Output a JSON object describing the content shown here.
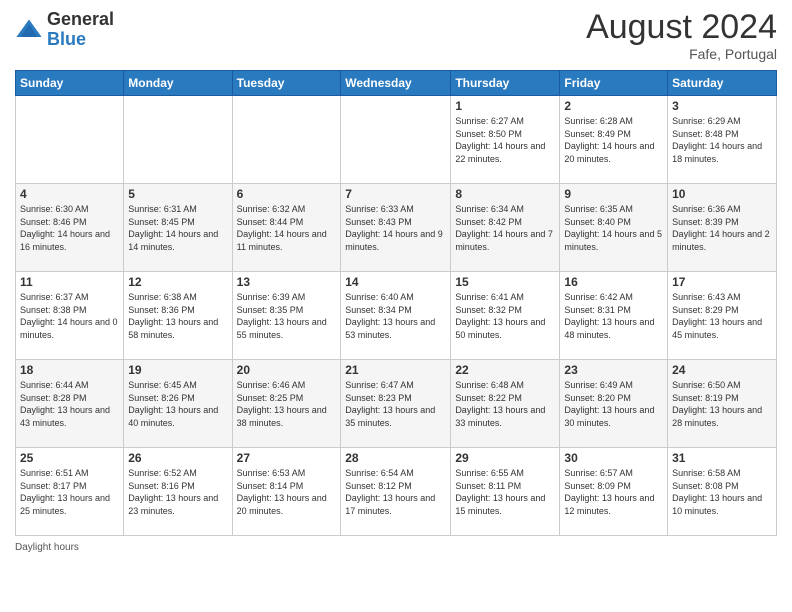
{
  "header": {
    "logo_general": "General",
    "logo_blue": "Blue",
    "month_year": "August 2024",
    "location": "Fafe, Portugal"
  },
  "days_of_week": [
    "Sunday",
    "Monday",
    "Tuesday",
    "Wednesday",
    "Thursday",
    "Friday",
    "Saturday"
  ],
  "weeks": [
    [
      {
        "day": "",
        "info": ""
      },
      {
        "day": "",
        "info": ""
      },
      {
        "day": "",
        "info": ""
      },
      {
        "day": "",
        "info": ""
      },
      {
        "day": "1",
        "info": "Sunrise: 6:27 AM\nSunset: 8:50 PM\nDaylight: 14 hours and 22 minutes."
      },
      {
        "day": "2",
        "info": "Sunrise: 6:28 AM\nSunset: 8:49 PM\nDaylight: 14 hours and 20 minutes."
      },
      {
        "day": "3",
        "info": "Sunrise: 6:29 AM\nSunset: 8:48 PM\nDaylight: 14 hours and 18 minutes."
      }
    ],
    [
      {
        "day": "4",
        "info": "Sunrise: 6:30 AM\nSunset: 8:46 PM\nDaylight: 14 hours and 16 minutes."
      },
      {
        "day": "5",
        "info": "Sunrise: 6:31 AM\nSunset: 8:45 PM\nDaylight: 14 hours and 14 minutes."
      },
      {
        "day": "6",
        "info": "Sunrise: 6:32 AM\nSunset: 8:44 PM\nDaylight: 14 hours and 11 minutes."
      },
      {
        "day": "7",
        "info": "Sunrise: 6:33 AM\nSunset: 8:43 PM\nDaylight: 14 hours and 9 minutes."
      },
      {
        "day": "8",
        "info": "Sunrise: 6:34 AM\nSunset: 8:42 PM\nDaylight: 14 hours and 7 minutes."
      },
      {
        "day": "9",
        "info": "Sunrise: 6:35 AM\nSunset: 8:40 PM\nDaylight: 14 hours and 5 minutes."
      },
      {
        "day": "10",
        "info": "Sunrise: 6:36 AM\nSunset: 8:39 PM\nDaylight: 14 hours and 2 minutes."
      }
    ],
    [
      {
        "day": "11",
        "info": "Sunrise: 6:37 AM\nSunset: 8:38 PM\nDaylight: 14 hours and 0 minutes."
      },
      {
        "day": "12",
        "info": "Sunrise: 6:38 AM\nSunset: 8:36 PM\nDaylight: 13 hours and 58 minutes."
      },
      {
        "day": "13",
        "info": "Sunrise: 6:39 AM\nSunset: 8:35 PM\nDaylight: 13 hours and 55 minutes."
      },
      {
        "day": "14",
        "info": "Sunrise: 6:40 AM\nSunset: 8:34 PM\nDaylight: 13 hours and 53 minutes."
      },
      {
        "day": "15",
        "info": "Sunrise: 6:41 AM\nSunset: 8:32 PM\nDaylight: 13 hours and 50 minutes."
      },
      {
        "day": "16",
        "info": "Sunrise: 6:42 AM\nSunset: 8:31 PM\nDaylight: 13 hours and 48 minutes."
      },
      {
        "day": "17",
        "info": "Sunrise: 6:43 AM\nSunset: 8:29 PM\nDaylight: 13 hours and 45 minutes."
      }
    ],
    [
      {
        "day": "18",
        "info": "Sunrise: 6:44 AM\nSunset: 8:28 PM\nDaylight: 13 hours and 43 minutes."
      },
      {
        "day": "19",
        "info": "Sunrise: 6:45 AM\nSunset: 8:26 PM\nDaylight: 13 hours and 40 minutes."
      },
      {
        "day": "20",
        "info": "Sunrise: 6:46 AM\nSunset: 8:25 PM\nDaylight: 13 hours and 38 minutes."
      },
      {
        "day": "21",
        "info": "Sunrise: 6:47 AM\nSunset: 8:23 PM\nDaylight: 13 hours and 35 minutes."
      },
      {
        "day": "22",
        "info": "Sunrise: 6:48 AM\nSunset: 8:22 PM\nDaylight: 13 hours and 33 minutes."
      },
      {
        "day": "23",
        "info": "Sunrise: 6:49 AM\nSunset: 8:20 PM\nDaylight: 13 hours and 30 minutes."
      },
      {
        "day": "24",
        "info": "Sunrise: 6:50 AM\nSunset: 8:19 PM\nDaylight: 13 hours and 28 minutes."
      }
    ],
    [
      {
        "day": "25",
        "info": "Sunrise: 6:51 AM\nSunset: 8:17 PM\nDaylight: 13 hours and 25 minutes."
      },
      {
        "day": "26",
        "info": "Sunrise: 6:52 AM\nSunset: 8:16 PM\nDaylight: 13 hours and 23 minutes."
      },
      {
        "day": "27",
        "info": "Sunrise: 6:53 AM\nSunset: 8:14 PM\nDaylight: 13 hours and 20 minutes."
      },
      {
        "day": "28",
        "info": "Sunrise: 6:54 AM\nSunset: 8:12 PM\nDaylight: 13 hours and 17 minutes."
      },
      {
        "day": "29",
        "info": "Sunrise: 6:55 AM\nSunset: 8:11 PM\nDaylight: 13 hours and 15 minutes."
      },
      {
        "day": "30",
        "info": "Sunrise: 6:57 AM\nSunset: 8:09 PM\nDaylight: 13 hours and 12 minutes."
      },
      {
        "day": "31",
        "info": "Sunrise: 6:58 AM\nSunset: 8:08 PM\nDaylight: 13 hours and 10 minutes."
      }
    ]
  ],
  "footer": {
    "daylight_label": "Daylight hours"
  }
}
